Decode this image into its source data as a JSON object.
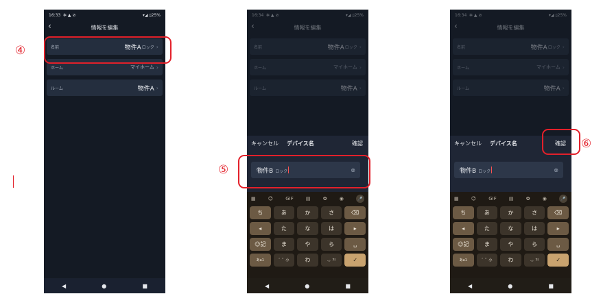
{
  "statusbar": {
    "p1_time": "16:33",
    "p2_time": "16:34",
    "p3_time": "16:34",
    "icons": "✻ ▲ ⊘",
    "battery": "▾◢ ▯25%"
  },
  "screen": {
    "back_icon": "‹",
    "title": "情報を編集",
    "chevron": "›"
  },
  "rows": {
    "name_label": "名前",
    "name_value": "物件A",
    "name_value_sub": "ロック",
    "home_label": "ホーム",
    "home_value": "マイホーム",
    "room_label": "ルーム",
    "room_value": "物件A"
  },
  "sheet": {
    "cancel": "キャンセル",
    "title": "デバイス名",
    "confirm": "確認",
    "input_main": "物件B",
    "input_sub": "ロック",
    "clear_icon": "⊗"
  },
  "keyboard": {
    "toolbar": [
      "▦",
      "☺",
      "GIF",
      "▤",
      "✿",
      "◉",
      "🎤"
    ],
    "rows": [
      [
        "ち",
        "あ",
        "か",
        "さ",
        "⌫"
      ],
      [
        "◂",
        "た",
        "な",
        "は",
        "▸"
      ],
      [
        "☺記",
        "ま",
        "や",
        "ら",
        "␣"
      ],
      [
        "あa1",
        "゛゜小",
        "わ",
        "、。?!",
        "✓"
      ]
    ]
  },
  "navbar": {
    "back": "◀",
    "home": "●",
    "recent": "■"
  },
  "annotations": {
    "step4": "④",
    "step5": "⑤",
    "step6": "⑥"
  },
  "colors": {
    "annotation_red": "#e3202a",
    "app_bg": "#141a24",
    "row_bg": "#242e3e",
    "keyboard_bg": "#1f1a14",
    "enter_key": "#c9a36f"
  }
}
